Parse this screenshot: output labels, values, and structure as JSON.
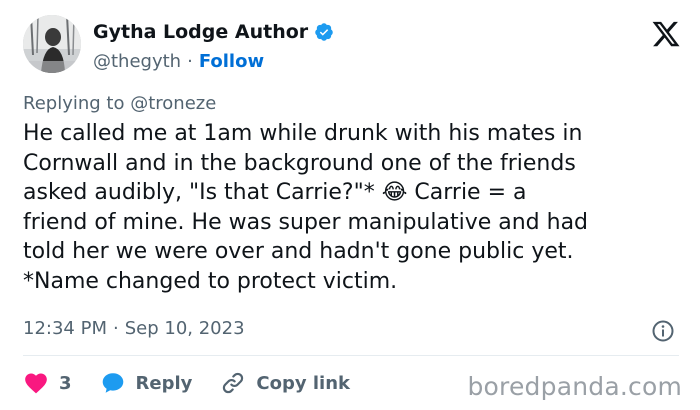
{
  "author": {
    "display_name": "Gytha Lodge Author",
    "handle": "@thegyth",
    "separator": "·",
    "follow_label": "Follow",
    "verified_icon": "verified-badge-icon"
  },
  "reply": {
    "prefix": "Replying to",
    "mention": "@troneze"
  },
  "tweet": {
    "text": "He called me at 1am while drunk with his mates in\nCornwall and in the background one of the friends\nasked audibly, \"Is that Carrie?\"* 😂 Carrie = a\nfriend of mine. He was super manipulative and had\ntold her we were over and hadn't gone public yet.\n*Name changed to protect victim.",
    "time": "12:34 PM",
    "separator": "·",
    "date": "Sep 10, 2023"
  },
  "actions": {
    "like_count": "3",
    "reply_label": "Reply",
    "copy_link_label": "Copy link"
  },
  "watermark": "boredpanda.com",
  "colors": {
    "accent": "#006fd6",
    "like": "#f91880",
    "reply_icon": "#1d9bf0",
    "secondary_text": "#536471",
    "primary_text": "#0f1419",
    "verified": "#1d9bf0"
  }
}
